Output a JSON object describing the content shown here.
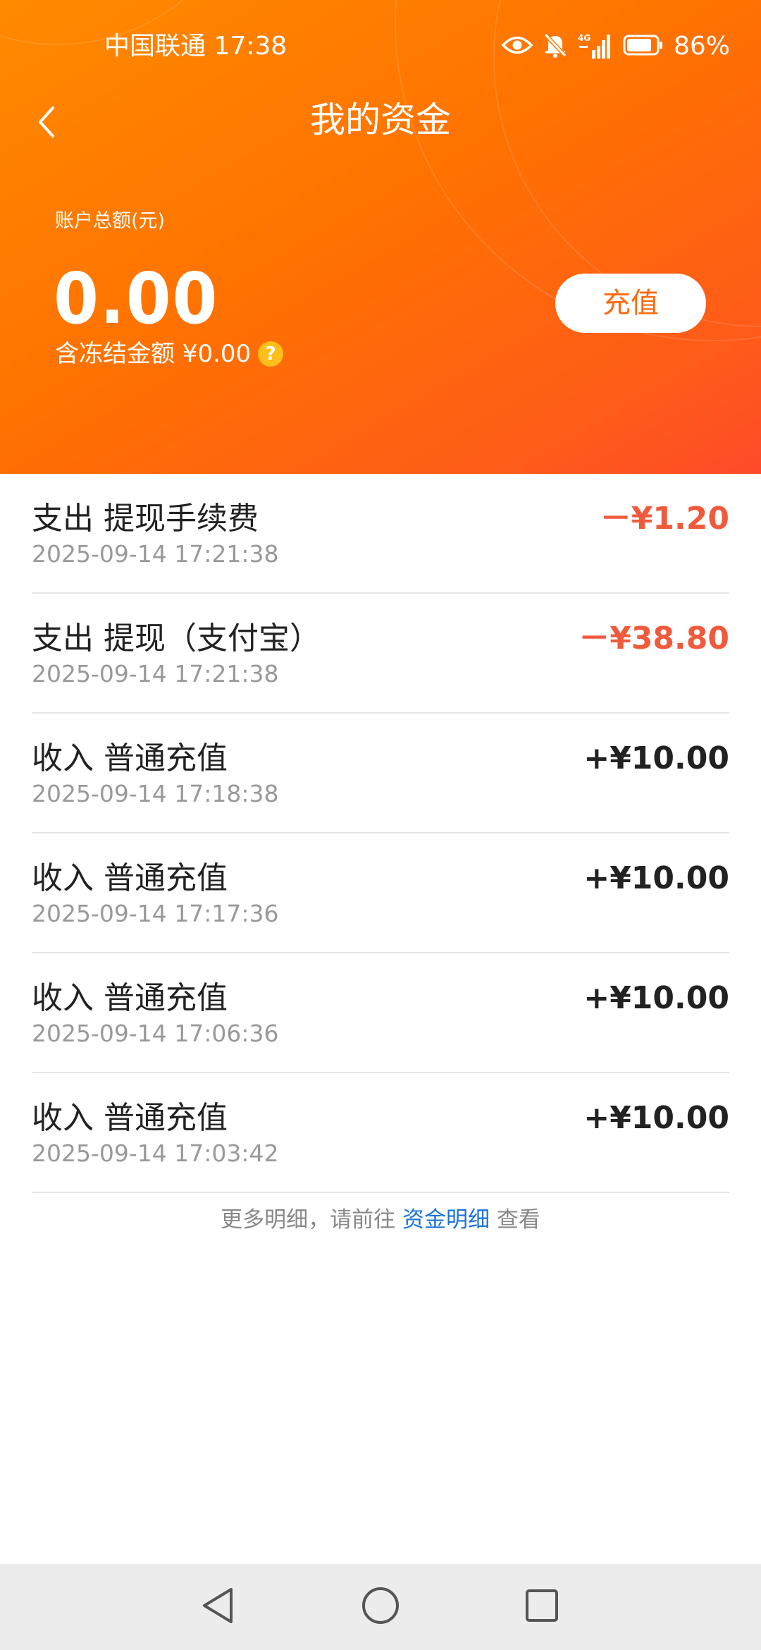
{
  "status_bar": {
    "carrier_time": "中国联通 17:38",
    "network": "4G",
    "battery_percent": "86%",
    "battery_level": 0.86
  },
  "nav": {
    "title": "我的资金",
    "back_icon": "chevron-left-icon"
  },
  "account": {
    "total_label": "账户总额(元)",
    "total_amount": "0.00",
    "frozen_label": "含冻结金额 ¥0.00",
    "help_icon": "question-mark-icon",
    "recharge_label": "充值"
  },
  "colors": {
    "header_orange": "#ff7a00",
    "expense_red": "#f05a3c",
    "income_dark": "#222222",
    "link_blue": "#1a73d9"
  },
  "transactions": [
    {
      "title": "支出 提现手续费",
      "time": "2025-09-14 17:21:38",
      "amount": "－¥1.20",
      "type": "expense"
    },
    {
      "title": "支出 提现（支付宝）",
      "time": "2025-09-14 17:21:38",
      "amount": "－¥38.80",
      "type": "expense"
    },
    {
      "title": "收入 普通充值",
      "time": "2025-09-14 17:18:38",
      "amount": "+¥10.00",
      "type": "income"
    },
    {
      "title": "收入 普通充值",
      "time": "2025-09-14 17:17:36",
      "amount": "+¥10.00",
      "type": "income"
    },
    {
      "title": "收入 普通充值",
      "time": "2025-09-14 17:06:36",
      "amount": "+¥10.00",
      "type": "income"
    },
    {
      "title": "收入 普通充值",
      "time": "2025-09-14 17:03:42",
      "amount": "+¥10.00",
      "type": "income"
    }
  ],
  "footer": {
    "prefix": "更多明细，请前往",
    "link": "资金明细",
    "suffix": "查看"
  },
  "system_nav": {
    "back": "triangle-back-icon",
    "home": "circle-home-icon",
    "recents": "square-recents-icon"
  }
}
